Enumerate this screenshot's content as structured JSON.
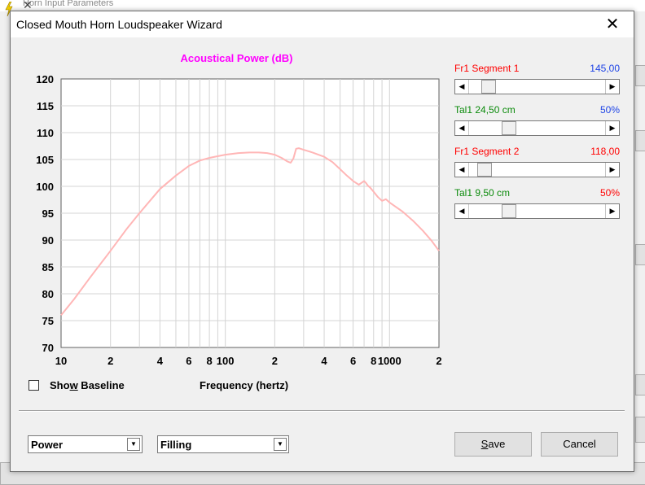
{
  "dialog": {
    "title": "Closed Mouth Horn Loudspeaker Wizard",
    "close_glyph": "✕"
  },
  "chart_data": {
    "type": "line",
    "title": "Acoustical Power (dB)",
    "xlabel": "Frequency (hertz)",
    "ylabel": "",
    "xscale": "log",
    "xlim": [
      10,
      2000
    ],
    "ylim": [
      70,
      120
    ],
    "grid": true,
    "yticks": [
      "120",
      "115",
      "110",
      "105",
      "100",
      "95",
      "90",
      "85",
      "80",
      "75",
      "70"
    ],
    "xticks": [
      "10",
      "2",
      "4",
      "6",
      "8",
      "100",
      "2",
      "4",
      "6",
      "8",
      "1000",
      "2"
    ],
    "series": [
      {
        "color": "#ffb6b6",
        "x": [
          10,
          12,
          15,
          20,
          25,
          30,
          40,
          50,
          60,
          70,
          80,
          100,
          120,
          140,
          160,
          180,
          200,
          220,
          240,
          250,
          260,
          270,
          280,
          300,
          340,
          400,
          450,
          500,
          550,
          600,
          650,
          700,
          720,
          740,
          760,
          800,
          850,
          900,
          950,
          1000,
          1200,
          1400,
          1600,
          1800,
          2000
        ],
        "y": [
          76,
          79,
          83,
          88,
          92,
          95,
          99.5,
          102,
          103.8,
          104.8,
          105.3,
          105.9,
          106.2,
          106.3,
          106.3,
          106.2,
          105.9,
          105.3,
          104.6,
          104.4,
          105.2,
          107,
          107.1,
          106.8,
          106.3,
          105.5,
          104.5,
          103.2,
          102,
          101,
          100.3,
          101,
          100.6,
          100.1,
          99.8,
          99,
          98,
          97.3,
          97.6,
          97,
          95.3,
          93.5,
          91.7,
          89.9,
          88
        ]
      }
    ]
  },
  "controls": {
    "sliders": [
      {
        "label": "Fr1  Segment 1",
        "value": "145,00",
        "label_color": "#ff0000",
        "value_color": "#1e44e6",
        "position": 0.1
      },
      {
        "label": "Tal1  24,50 cm",
        "value": "50%",
        "label_color": "#0a8a0a",
        "value_color": "#1e44e6",
        "position": 0.27
      },
      {
        "label": "Fr1  Segment 2",
        "value": "118,00",
        "label_color": "#ff0000",
        "value_color": "#ff0000",
        "position": 0.07
      },
      {
        "label": "Tal1  9,50 cm",
        "value": "50%",
        "label_color": "#0a8a0a",
        "value_color": "#ff0000",
        "position": 0.27
      }
    ],
    "show_baseline": {
      "checked": false,
      "label_pre": "Sho",
      "label_mnemonic": "w",
      "label_post": " Baseline"
    },
    "dropdown_mode": "Power",
    "dropdown_filling": "Filling",
    "save_pre": "",
    "save_mnemonic": "S",
    "save_post": "ave",
    "cancel_label": "Cancel"
  },
  "background": {
    "title_fragment": "Horn    Input Parameters",
    "close_glyph": "✕"
  }
}
